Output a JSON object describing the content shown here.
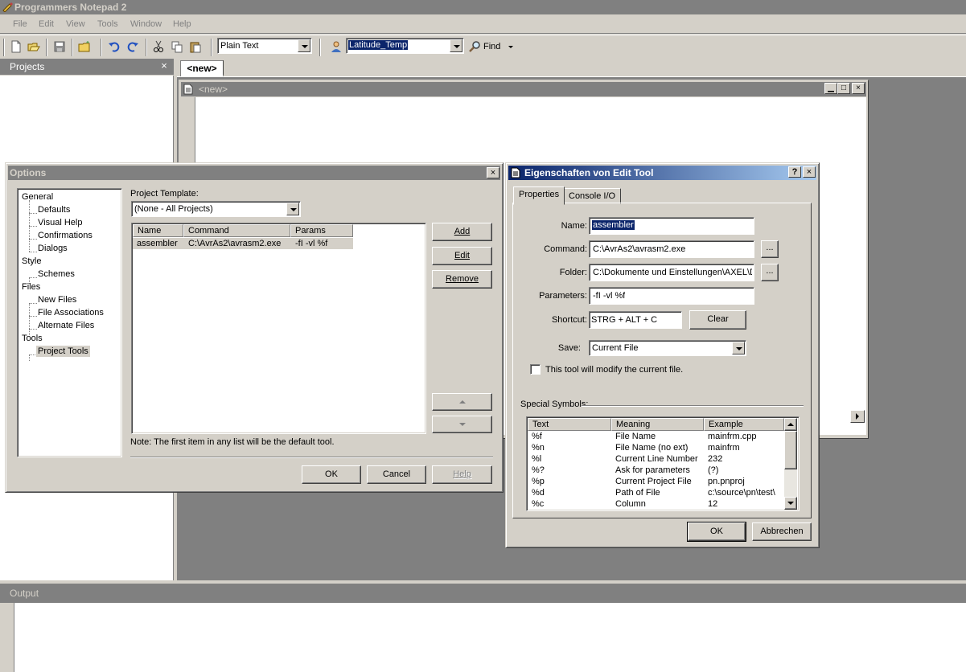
{
  "app": {
    "title": "Programmers Notepad 2"
  },
  "menu": [
    "File",
    "Edit",
    "View",
    "Tools",
    "Window",
    "Help"
  ],
  "toolbar": {
    "scheme_select": "Plain Text",
    "search_combo": "Latitude_Temp",
    "find_label": "Find"
  },
  "projects_panel": {
    "title": "Projects",
    "close": "×"
  },
  "document": {
    "tab_label": "<new>",
    "window_title": "<new>"
  },
  "output_panel": {
    "title": "Output"
  },
  "options_dialog": {
    "title": "Options",
    "close": "×",
    "tree": [
      {
        "label": "General",
        "level": 0
      },
      {
        "label": "Defaults",
        "level": 1
      },
      {
        "label": "Visual Help",
        "level": 1
      },
      {
        "label": "Confirmations",
        "level": 1
      },
      {
        "label": "Dialogs",
        "level": 1
      },
      {
        "label": "Style",
        "level": 0
      },
      {
        "label": "Schemes",
        "level": 1
      },
      {
        "label": "Files",
        "level": 0
      },
      {
        "label": "New Files",
        "level": 1
      },
      {
        "label": "File Associations",
        "level": 1
      },
      {
        "label": "Alternate Files",
        "level": 1
      },
      {
        "label": "Tools",
        "level": 0
      },
      {
        "label": "Project Tools",
        "level": 1,
        "selected": true
      }
    ],
    "project_template_label": "Project Template:",
    "project_template_value": "(None - All Projects)",
    "columns": [
      "Name",
      "Command",
      "Params"
    ],
    "tools": [
      {
        "name": "assembler",
        "command": "C:\\AvrAs2\\avrasm2.exe",
        "params": "-fI -vl %f"
      }
    ],
    "buttons": {
      "add": "Add",
      "edit": "Edit",
      "remove": "Remove",
      "ok": "OK",
      "cancel": "Cancel",
      "help": "Help"
    },
    "note": "Note: The first item in any list will be the default tool."
  },
  "props_dialog": {
    "title": "Eigenschaften von Edit Tool",
    "help": "?",
    "close": "×",
    "tabs": [
      "Properties",
      "Console I/O"
    ],
    "labels": {
      "name": "Name:",
      "command": "Command:",
      "folder": "Folder:",
      "parameters": "Parameters:",
      "shortcut": "Shortcut:",
      "save": "Save:"
    },
    "values": {
      "name": "assembler",
      "command": "C:\\AvrAs2\\avrasm2.exe",
      "folder": "C:\\Dokumente und Einstellungen\\AXEL\\D",
      "parameters": "-fI -vl %f",
      "shortcut": "STRG + ALT + C",
      "save": "Current File"
    },
    "browse": "...",
    "clear": "Clear",
    "checkbox_label": "This tool will modify the current file.",
    "special_symbols_label": "Special Symbols:",
    "symbol_columns": [
      "Text",
      "Meaning",
      "Example"
    ],
    "symbols": [
      {
        "text": "%f",
        "meaning": "File Name",
        "example": "mainfrm.cpp"
      },
      {
        "text": "%n",
        "meaning": "File Name (no ext)",
        "example": "mainfrm"
      },
      {
        "text": "%l",
        "meaning": "Current Line Number",
        "example": "232"
      },
      {
        "text": "%?",
        "meaning": "Ask for parameters",
        "example": "(?)"
      },
      {
        "text": "%p",
        "meaning": "Current Project File",
        "example": "pn.pnproj"
      },
      {
        "text": "%d",
        "meaning": "Path of File",
        "example": "c:\\source\\pn\\test\\"
      },
      {
        "text": "%c",
        "meaning": "Column",
        "example": "12"
      }
    ],
    "buttons": {
      "ok": "OK",
      "cancel": "Abbrechen"
    }
  }
}
